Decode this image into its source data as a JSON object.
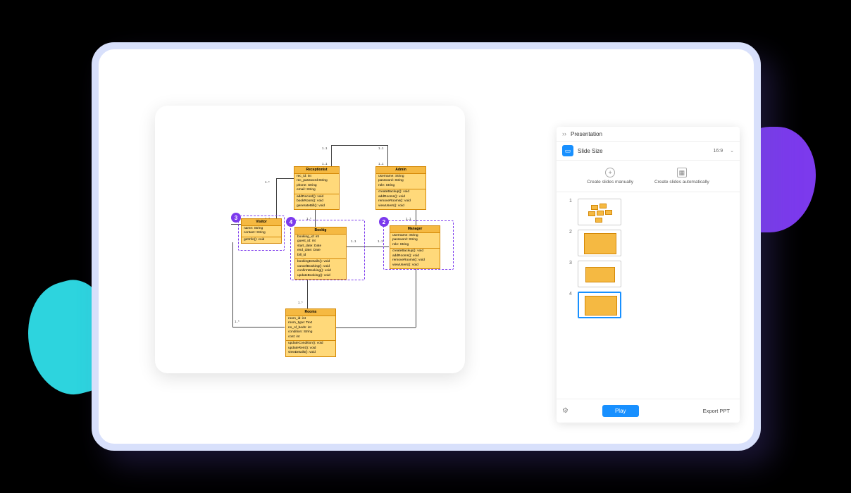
{
  "uml": {
    "receptionist": {
      "title": "Receptionist",
      "attrs": "rec_id: int\nrec_password:String\nphone: String\nemail: String",
      "ops": "addRecord(): void\nbookRoom(): void\ngenerateBill(): void"
    },
    "admin": {
      "title": "Admin",
      "attrs": "username: String\npassword: String\nrole: String",
      "ops": "createBackup(): void\naddRooms(): void\nremoveRooms(): void\nviewUsers(): void"
    },
    "visitor": {
      "title": "Visitor",
      "attrs": "name: String\ncontact: String",
      "ops": "getInfo(): void"
    },
    "booking": {
      "title": "Bookig",
      "attrs": "booking_id: int\nguest_id: int\nstart_date: Date\nend_date: Date\nbill_id",
      "ops": "bookingDetails(): void\ncancelBooking(): void\nconfirmBooking(): void\nupdateBooking(): void"
    },
    "manager": {
      "title": "Manager",
      "attrs": "username: String\npassword: String\nrole: String",
      "ops": "createBackup(): void\naddRooms(): void\nremoveRooms(): void\nviewUsers(): void"
    },
    "rooms": {
      "title": "Rooms",
      "attrs": "room_id: int\nroom_type: Text\nno_of_beds: int\ncondition: String\ncost: int",
      "ops": "updateCondition(): void\nupdateRent(): void\nviewDetails(): void"
    }
  },
  "badges": {
    "b2": "2",
    "b3": "3",
    "b4": "4"
  },
  "mult": {
    "one_one": "1..1",
    "one_many": "1..*"
  },
  "panel": {
    "title": "Presentation",
    "slide_size_label": "Slide Size",
    "ratio": "16:9",
    "create_manual": "Create slides manually",
    "create_auto": "Create slides automatically",
    "play": "Play",
    "export": "Export PPT",
    "slides": [
      {
        "n": "1"
      },
      {
        "n": "2"
      },
      {
        "n": "3"
      },
      {
        "n": "4"
      }
    ]
  }
}
